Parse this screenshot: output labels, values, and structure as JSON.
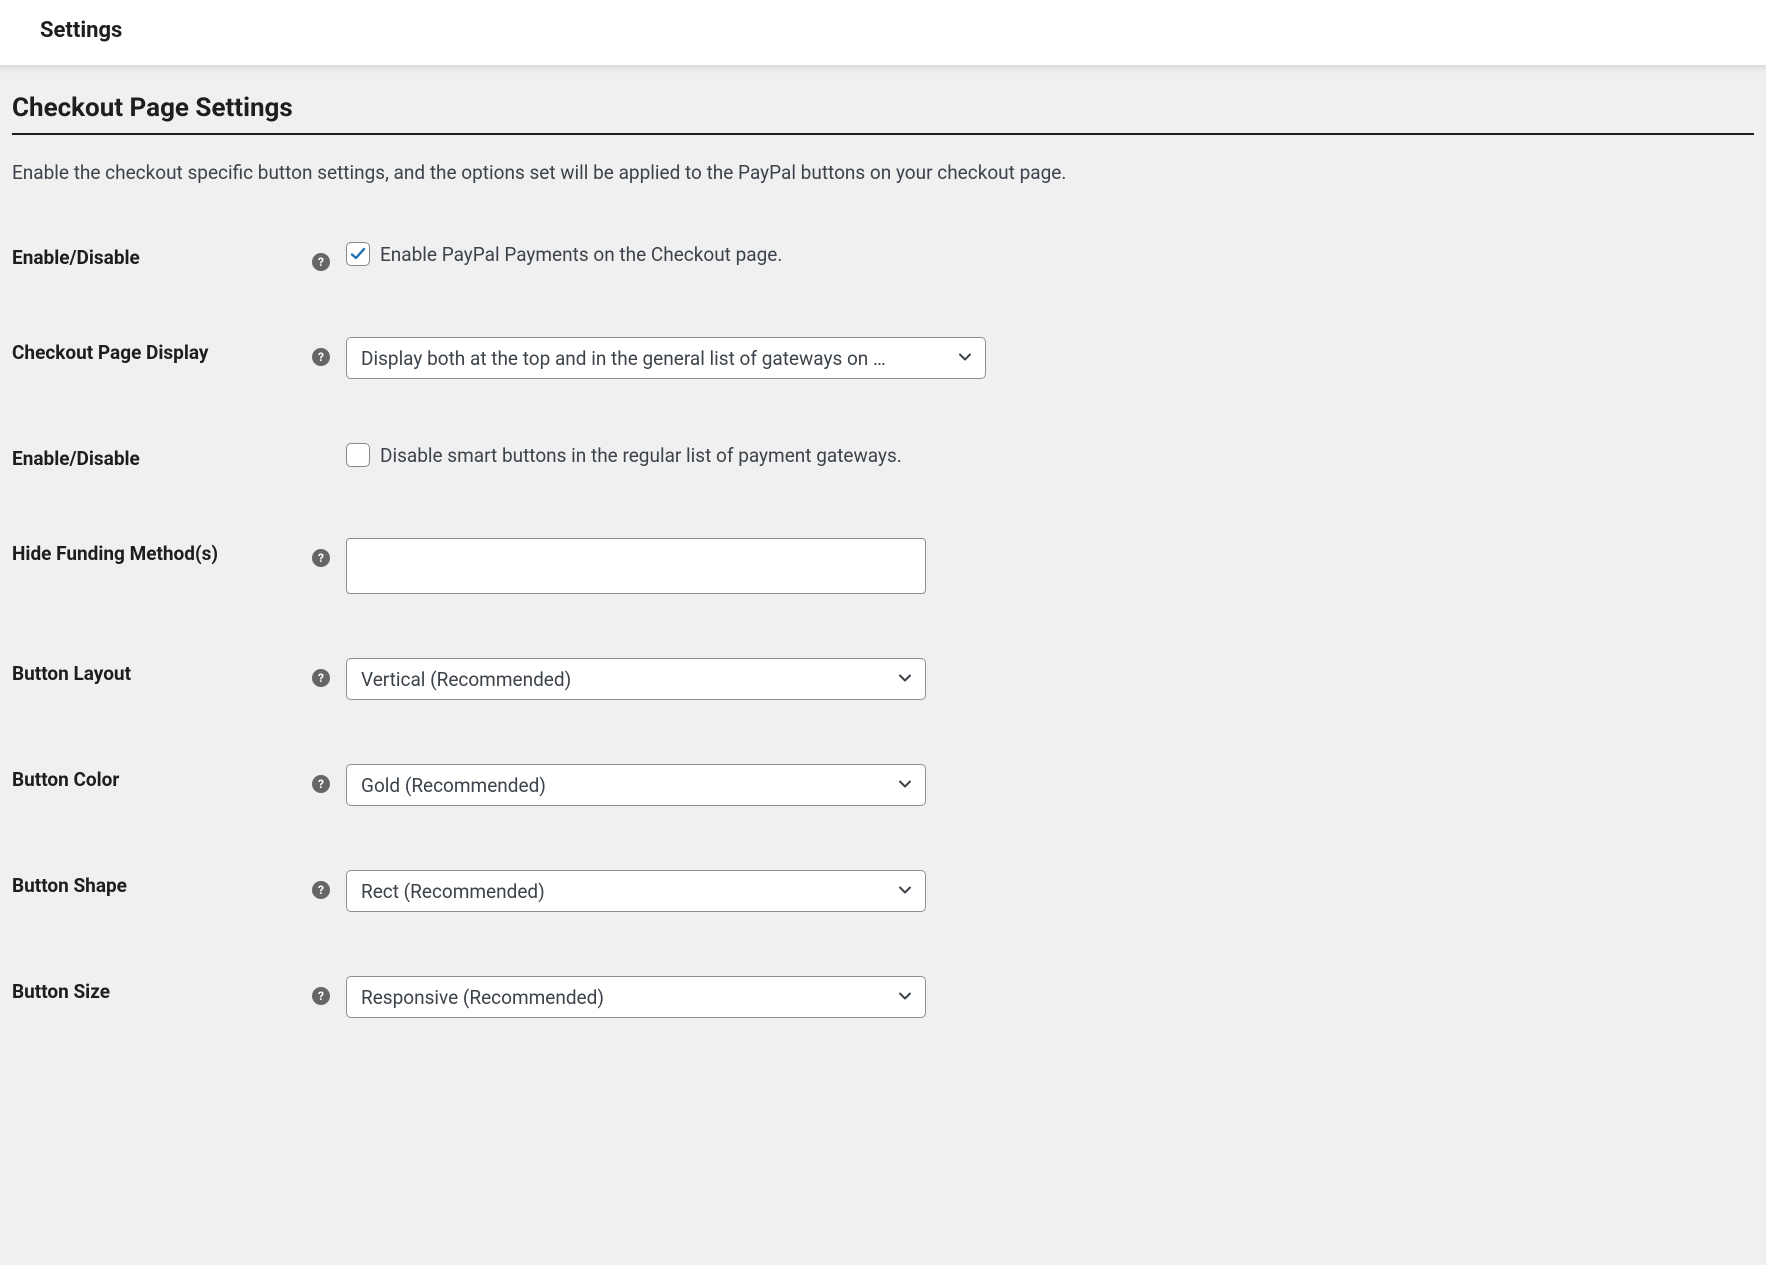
{
  "topbar": {
    "title": "Settings"
  },
  "section": {
    "title": "Checkout Page Settings",
    "description": "Enable the checkout specific button settings, and the options set will be applied to the PayPal buttons on your checkout page."
  },
  "rows": {
    "enable1": {
      "label": "Enable/Disable",
      "checked": true,
      "text": "Enable PayPal Payments on the Checkout page.",
      "has_help": true
    },
    "display": {
      "label": "Checkout Page Display",
      "value": "Display both at the top and in the general list of gateways on …",
      "has_help": true
    },
    "enable2": {
      "label": "Enable/Disable",
      "checked": false,
      "text": "Disable smart buttons in the regular list of payment gateways.",
      "has_help": false
    },
    "hide_funding": {
      "label": "Hide Funding Method(s)",
      "has_help": true
    },
    "button_layout": {
      "label": "Button Layout",
      "value": "Vertical (Recommended)",
      "has_help": true
    },
    "button_color": {
      "label": "Button Color",
      "value": "Gold (Recommended)",
      "has_help": true
    },
    "button_shape": {
      "label": "Button Shape",
      "value": "Rect (Recommended)",
      "has_help": true
    },
    "button_size": {
      "label": "Button Size",
      "value": "Responsive (Recommended)",
      "has_help": true
    }
  }
}
